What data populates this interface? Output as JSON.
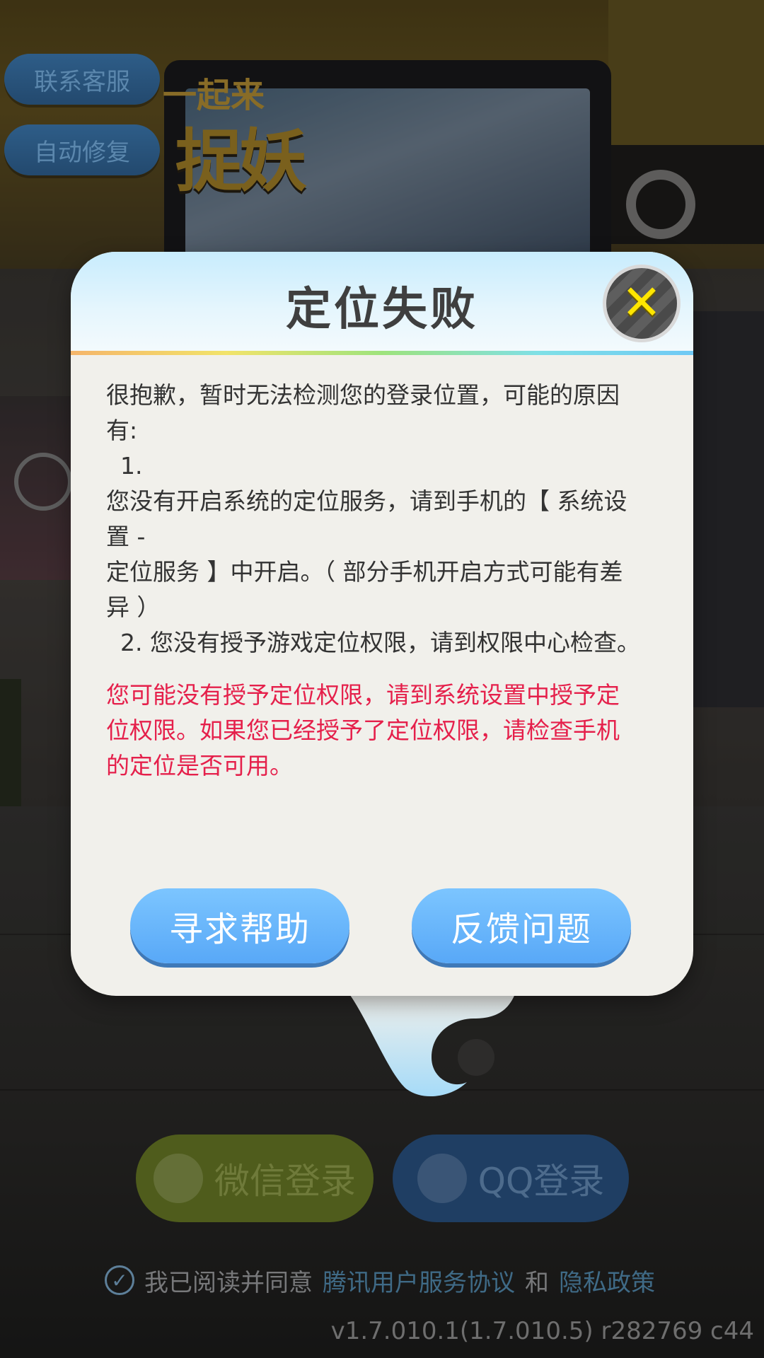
{
  "app": {
    "logo_small": "一起来",
    "logo_big": "捉妖"
  },
  "side_buttons": {
    "contact": "联系客服",
    "repair": "自动修复"
  },
  "dialog": {
    "title": "定位失败",
    "lines": [
      "很抱歉，暂时无法检测您的登录位置，可能的原因",
      "有:",
      "1.",
      "您没有开启系统的定位服务，请到手机的【 系统设",
      "置 -",
      "定位服务 】中开启。（ 部分手机开启方式可能有差",
      "异 ）",
      "2. 您没有授予游戏定位权限，请到权限中心检查。"
    ],
    "warning_lines": [
      "您可能没有授予定位权限，请到系统设置中授予定",
      "位权限。如果您已经授予了定位权限，请检查手机",
      "的定位是否可用。"
    ],
    "help_button": "寻求帮助",
    "feedback_button": "反馈问题",
    "close_icon": "close-icon"
  },
  "login": {
    "wechat": "微信登录",
    "qq": "QQ登录",
    "agree_prefix": "我已阅读并同意",
    "terms_link": "腾讯用户服务协议",
    "and": "和",
    "privacy_link": "隐私政策"
  },
  "version": "v1.7.010.1(1.7.010.5) r282769 c44",
  "colors": {
    "accent_blue": "#58a8f7",
    "warning_red": "#e5204b",
    "close_yellow": "#ffe600"
  }
}
